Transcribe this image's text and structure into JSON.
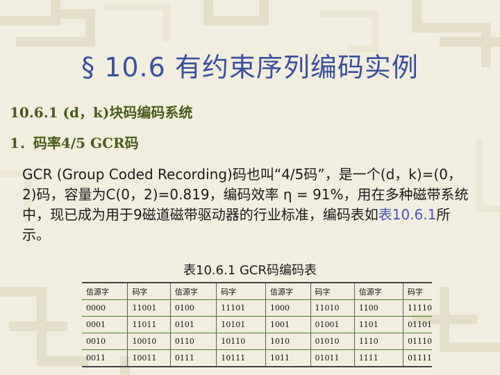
{
  "title": "§ 10.6 有约束序列编码实例",
  "subheading_1": "10.6.1 (d，k)块码编码系统",
  "subheading_2": "1．码率4/5 GCR码",
  "paragraph": {
    "text": "GCR (Group Coded Recording)码也叫“4/5码”，是一个(d，k)=(0，2)码，容量为C(0，2)=0.819，编码效率 η = 91%，用在多种磁带系统中，现已成为用于9磁道磁带驱动器的行业标准，编码表如",
    "link_text": "表10.6.1",
    "tail": "所示。"
  },
  "table_caption": "表10.6.1  GCR码编码表",
  "table": {
    "headers": [
      "信源字",
      "码字",
      "信源字",
      "码字",
      "信源字",
      "码字",
      "信源字",
      "码字"
    ],
    "rows": [
      [
        "0000",
        "11001",
        "0100",
        "11101",
        "1000",
        "11010",
        "1100",
        "11110"
      ],
      [
        "0001",
        "11011",
        "0101",
        "10101",
        "1001",
        "01001",
        "1101",
        "01101"
      ],
      [
        "0010",
        "10010",
        "0110",
        "10110",
        "1010",
        "01010",
        "1110",
        "01110"
      ],
      [
        "0011",
        "10011",
        "0111",
        "10111",
        "1011",
        "01011",
        "1111",
        "01111"
      ]
    ]
  },
  "colors": {
    "background": "#f1eedf",
    "title": "#3a4f9e",
    "subheading": "#4a5a1d",
    "link": "#4c54b8"
  }
}
